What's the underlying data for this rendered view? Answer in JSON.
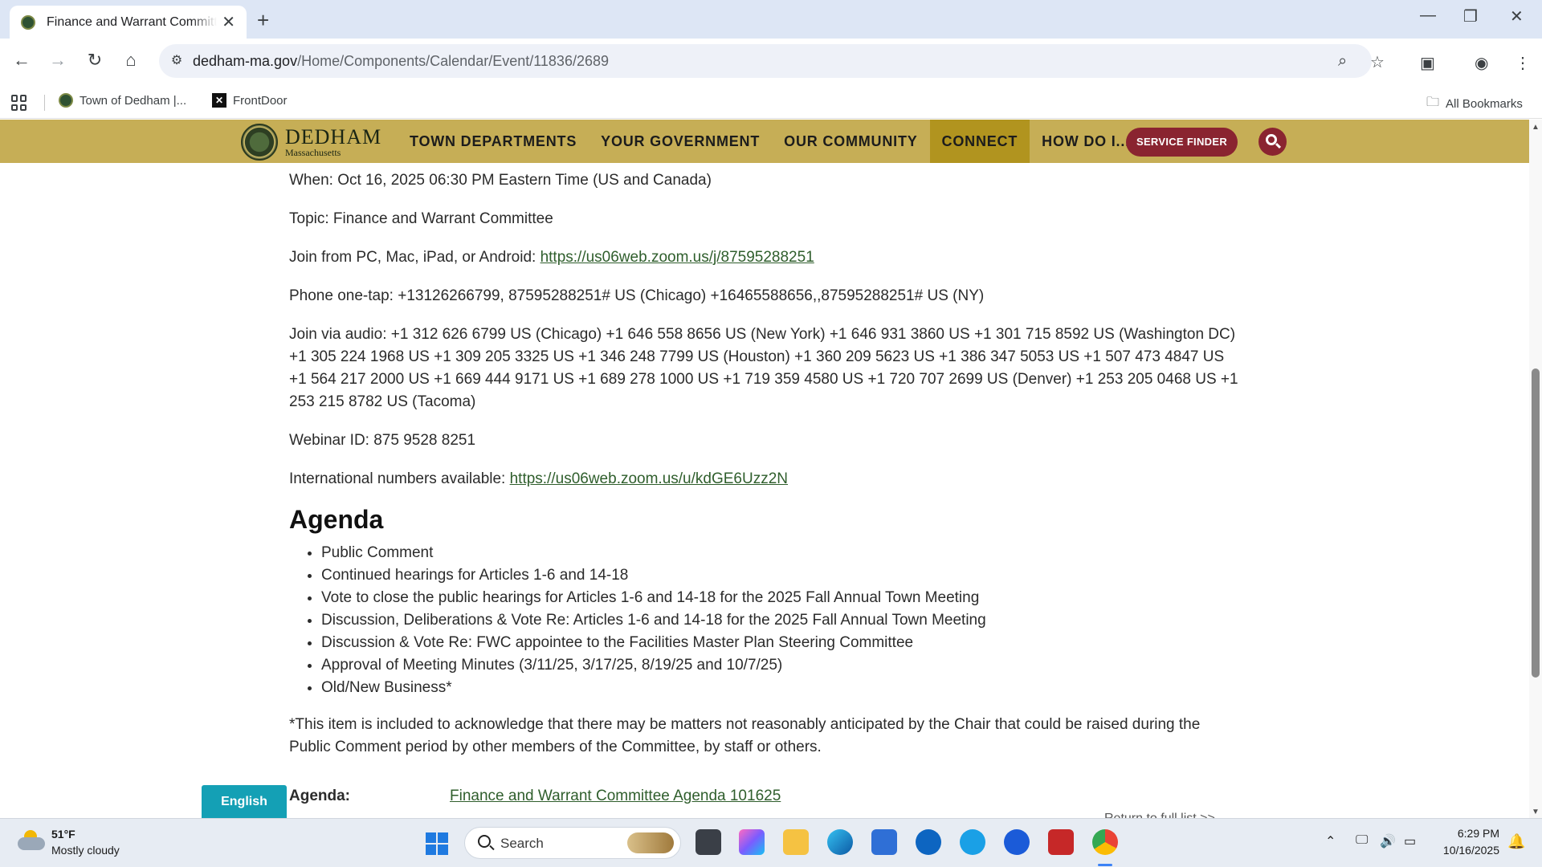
{
  "browser": {
    "tab_title": "Finance and Warrant Committee",
    "url_host": "dedham-ma.gov",
    "url_path": "/Home/Components/Calendar/Event/11836/2689",
    "bookmarks": [
      {
        "label": "Town of Dedham |..."
      },
      {
        "label": "FrontDoor"
      }
    ],
    "all_bookmarks": "All Bookmarks"
  },
  "site": {
    "logo_name": "DEDHAM",
    "logo_sub": "Massachusetts",
    "nav": [
      {
        "label": "TOWN DEPARTMENTS"
      },
      {
        "label": "YOUR GOVERNMENT"
      },
      {
        "label": "OUR COMMUNITY"
      },
      {
        "label": "CONNECT"
      },
      {
        "label": "HOW DO I..."
      }
    ],
    "service_finder": "SERVICE FINDER",
    "brand_color": "#c6ae56",
    "accent_color": "#8a2430"
  },
  "content": {
    "when": "When: Oct 16, 2025 06:30 PM Eastern Time (US and Canada)",
    "topic": "Topic: Finance and Warrant Committee",
    "join_pc_label": "Join from PC, Mac, iPad, or Android: ",
    "join_pc_link": "https://us06web.zoom.us/j/87595288251",
    "phone_onetap": "Phone one-tap: +13126266799, 87595288251# US (Chicago) +16465588656,,87595288251# US (NY)",
    "join_audio": "Join via audio: +1 312 626 6799 US (Chicago) +1 646 558 8656 US (New York) +1 646 931 3860 US +1 301 715 8592 US (Washington DC) +1 305 224 1968 US +1 309 205 3325 US +1 346 248 7799 US (Houston) +1 360 209 5623 US +1 386 347 5053 US +1 507 473 4847 US +1 564 217 2000 US +1 669 444 9171 US +1 689 278 1000 US +1 719 359 4580 US +1 720 707 2699 US (Denver) +1 253 205 0468 US +1 253 215 8782 US (Tacoma)",
    "webinar_id": "Webinar ID: 875 9528 8251",
    "intl_label": "International numbers available: ",
    "intl_link": "https://us06web.zoom.us/u/kdGE6Uzz2N",
    "agenda_heading": "Agenda",
    "agenda_items": [
      "Public Comment",
      "Continued hearings for Articles 1-6 and 14-18",
      "Vote to close the public hearings for Articles 1-6 and 14-18 for the 2025 Fall Annual Town Meeting",
      "Discussion, Deliberations & Vote Re: Articles 1-6 and 14-18 for the 2025 Fall Annual Town Meeting",
      "Discussion & Vote Re: FWC appointee to the Facilities Master Plan Steering Committee",
      "Approval of Meeting Minutes (3/11/25, 3/17/25, 8/19/25 and 10/7/25)",
      "Old/New Business*"
    ],
    "footnote": "*This item is included to acknowledge that there may be matters not reasonably anticipated by the Chair that could be raised during the Public Comment period by other members of the Committee, by staff or others.",
    "agenda_label": "Agenda:",
    "agenda_doc_link": "Finance and Warrant Committee Agenda 101625",
    "return_link": "Return to full list >>",
    "language_button": "English"
  },
  "taskbar": {
    "temperature": "51°F",
    "weather": "Mostly cloudy",
    "search_placeholder": "Search",
    "time": "6:29 PM",
    "date": "10/16/2025"
  }
}
